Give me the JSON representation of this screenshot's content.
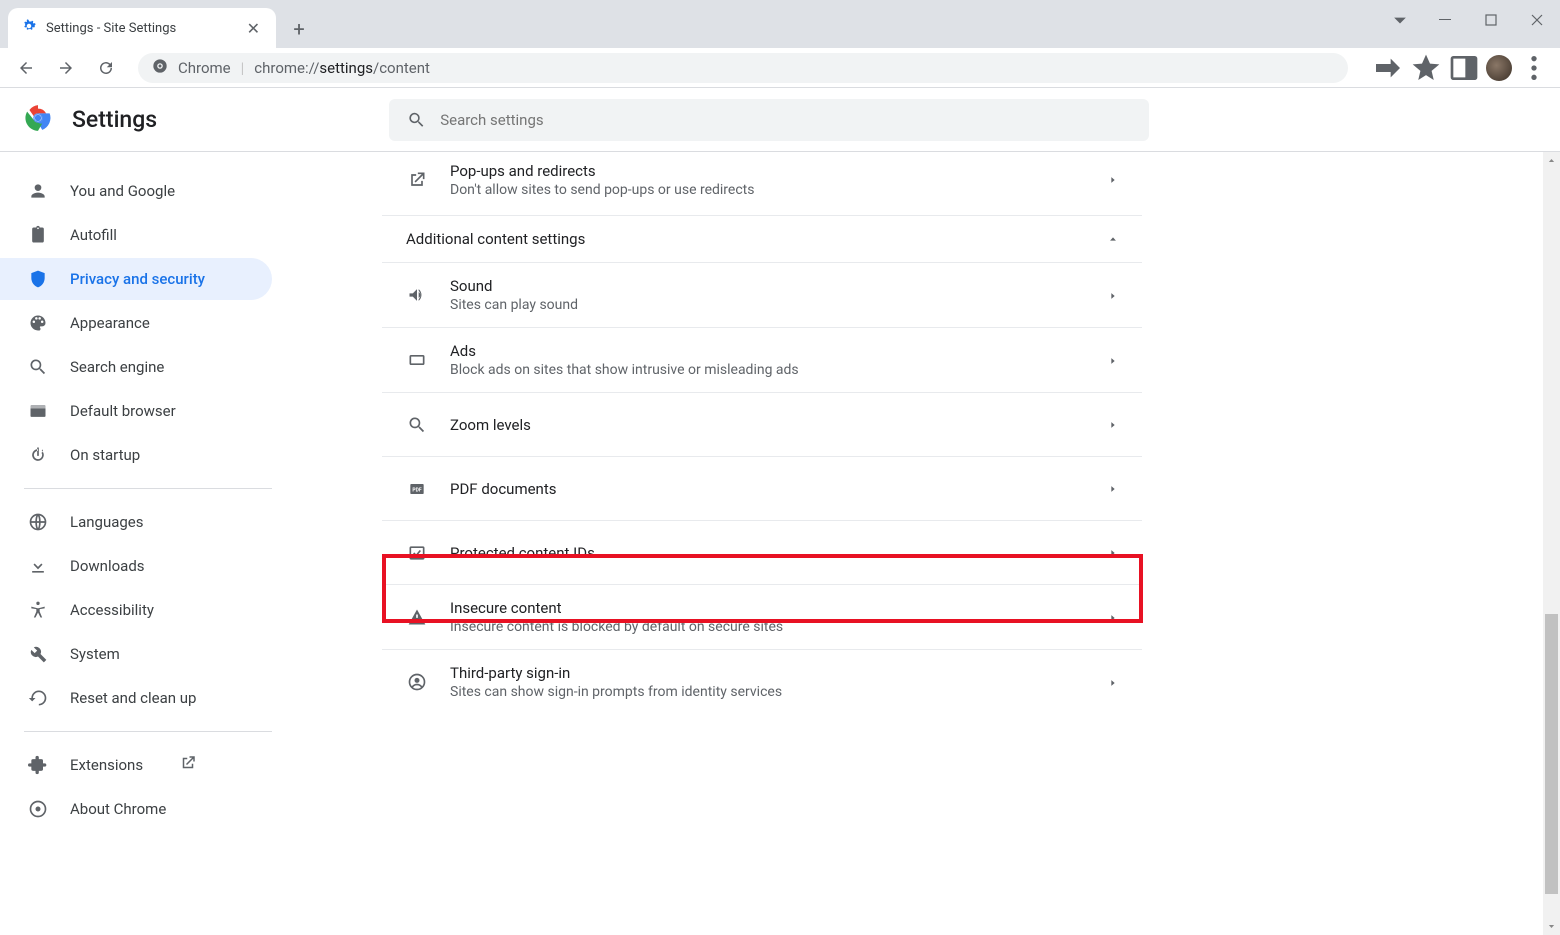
{
  "tab": {
    "title": "Settings - Site Settings"
  },
  "omnibox": {
    "scheme_label": "Chrome",
    "url_prefix": "chrome://",
    "url_bold": "settings",
    "url_rest": "/content"
  },
  "header": {
    "title": "Settings",
    "search_placeholder": "Search settings"
  },
  "sidebar": {
    "items": [
      {
        "label": "You and Google"
      },
      {
        "label": "Autofill"
      },
      {
        "label": "Privacy and security"
      },
      {
        "label": "Appearance"
      },
      {
        "label": "Search engine"
      },
      {
        "label": "Default browser"
      },
      {
        "label": "On startup"
      }
    ],
    "items2": [
      {
        "label": "Languages"
      },
      {
        "label": "Downloads"
      },
      {
        "label": "Accessibility"
      },
      {
        "label": "System"
      },
      {
        "label": "Reset and clean up"
      }
    ],
    "items3": [
      {
        "label": "Extensions"
      },
      {
        "label": "About Chrome"
      }
    ]
  },
  "main": {
    "popups": {
      "title": "Pop-ups and redirects",
      "sub": "Don't allow sites to send pop-ups or use redirects"
    },
    "section_head": "Additional content settings",
    "sound": {
      "title": "Sound",
      "sub": "Sites can play sound"
    },
    "ads": {
      "title": "Ads",
      "sub": "Block ads on sites that show intrusive or misleading ads"
    },
    "zoom": {
      "title": "Zoom levels"
    },
    "pdf": {
      "title": "PDF documents"
    },
    "protected": {
      "title": "Protected content IDs"
    },
    "insecure": {
      "title": "Insecure content",
      "sub": "Insecure content is blocked by default on secure sites"
    },
    "third": {
      "title": "Third-party sign-in",
      "sub": "Sites can show sign-in prompts from identity services"
    }
  }
}
